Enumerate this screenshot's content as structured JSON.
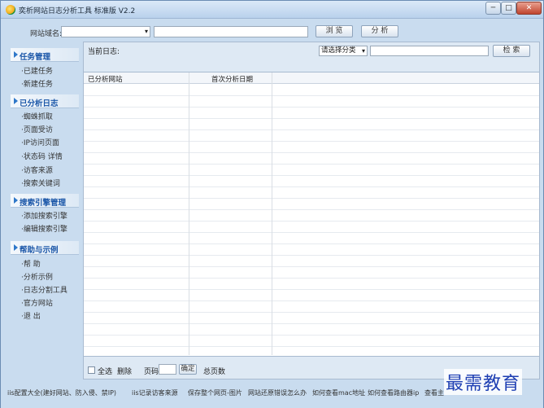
{
  "window": {
    "title": "奕析网站日志分析工具 标准版 V2.2",
    "controls": {
      "minimize": "─",
      "maximize": "□",
      "close": "✕"
    }
  },
  "toolbar": {
    "site_label": "网站域名:",
    "site_value": "",
    "path_value": "",
    "browse_label": "浏 览",
    "analyze_label": "分 析"
  },
  "sidebar": {
    "sections": [
      {
        "title": "任务管理",
        "items": [
          "·已建任务",
          "·新建任务"
        ]
      },
      {
        "title": "已分析日志",
        "items": [
          "·蜘蛛抓取",
          "·页面受访",
          "·IP访问页面",
          "·状态码  详情",
          "·访客来源",
          "·搜索关键词"
        ]
      },
      {
        "title": "搜索引擎管理",
        "items": [
          "·添加搜索引擎",
          "·编辑搜索引擎"
        ]
      },
      {
        "title": "帮助与示例",
        "items": [
          "·帮  助",
          "·分析示例",
          "·日志分割工具",
          "·官方网站",
          "·退  出"
        ]
      }
    ]
  },
  "main": {
    "log_label": "当前日志:",
    "category_select": "请选择分类",
    "search_value": "",
    "search_label": "检 索",
    "columns": [
      "已分析网站",
      "首次分析日期"
    ],
    "rows": []
  },
  "bottom": {
    "select_all": "全选",
    "delete": "删除",
    "page_label": "页码",
    "page_value": "",
    "ok": "确定",
    "total_pages": "总页数"
  },
  "footer": {
    "links": [
      "iis配置大全(建好网站、防入侵、禁IP)",
      "iis记录访客来源",
      "保存整个网页-图片",
      "网站还原错误怎么办",
      "如何查看mac地址",
      "如何查看路由器ip",
      "查看主"
    ]
  },
  "watermark": "最需教育",
  "colors": {
    "accent": "#1a56a8",
    "chrome": "#c9dcef",
    "panel": "#dee9f4",
    "watermark": "#1e3fb3"
  }
}
